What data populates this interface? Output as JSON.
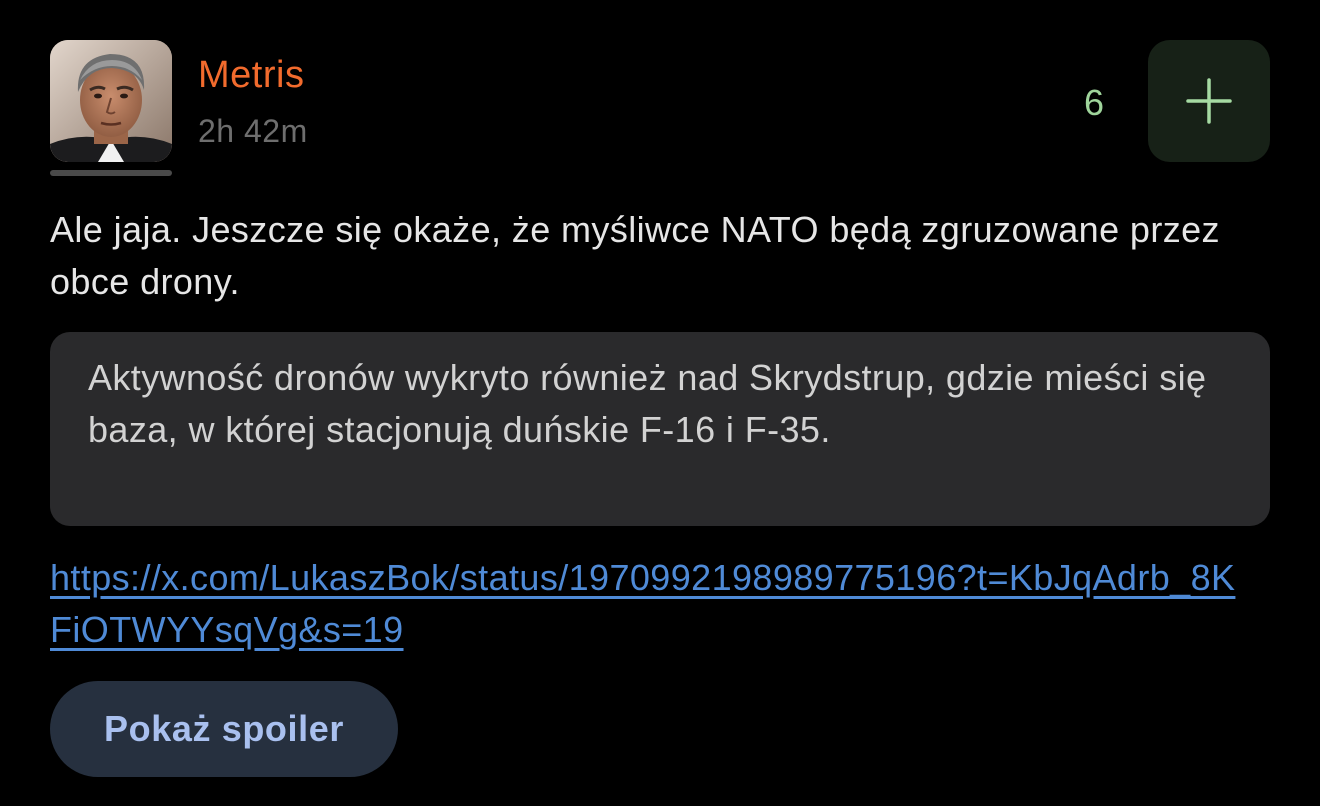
{
  "post": {
    "author": "Metris",
    "time": "2h 42m",
    "votes": "6",
    "body": "Ale jaja. Jeszcze się okaże, że myśliwce NATO będą zgruzowane przez obce drony.",
    "quote": "Aktywność dronów wykryto również nad Skrydstrup, gdzie mieści się baza, w której stacjonują duńskie F-16 i F-35.",
    "link": "https://x.com/LukaszBok/status/1970992198989775196?t=KbJqAdrb_8KFiOTWYYsqVg&s=19",
    "spoiler_label": "Pokaż spoiler"
  },
  "icons": {
    "vote_button": "plus-icon",
    "avatar": "avatar-photo"
  },
  "colors": {
    "background": "#000000",
    "author": "#f26b2d",
    "timestamp": "#6e6e6e",
    "body_text": "#e6e6e6",
    "vote_count": "#9fd49b",
    "vote_button_bg": "#172117",
    "vote_icon": "#a6dba3",
    "quote_bg": "#2a2a2c",
    "quote_text": "#d2d2d2",
    "link": "#4f8ad6",
    "spoiler_bg": "#26303f",
    "spoiler_text": "#a9c0ef"
  }
}
